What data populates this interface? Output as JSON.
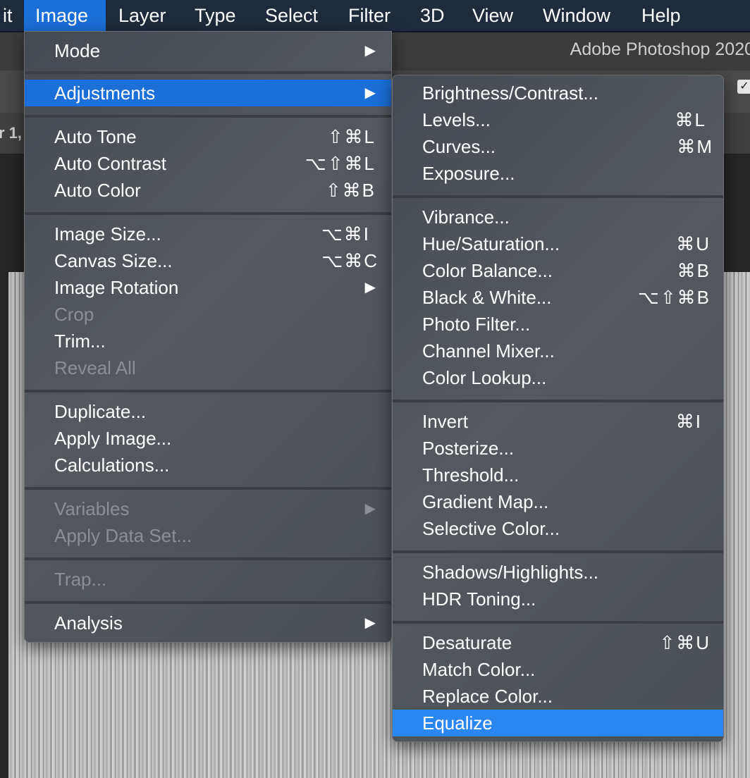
{
  "menubar": {
    "items": [
      "it",
      "Image",
      "Layer",
      "Type",
      "Select",
      "Filter",
      "3D",
      "View",
      "Window",
      "Help"
    ],
    "active": "Image"
  },
  "app": {
    "title": "Adobe Photoshop 2020",
    "tab_partial": "r 1,"
  },
  "image_menu": {
    "items": [
      {
        "label": "Mode",
        "submenu": true
      },
      {
        "label": "Adjustments",
        "submenu": true,
        "highlighted": true
      },
      {
        "label": "Auto Tone",
        "shortcut": "⇧⌘L"
      },
      {
        "label": "Auto Contrast",
        "shortcut": "⌥⇧⌘L"
      },
      {
        "label": "Auto Color",
        "shortcut": "⇧⌘B"
      },
      {
        "label": "Image Size...",
        "shortcut": "⌥⌘I"
      },
      {
        "label": "Canvas Size...",
        "shortcut": "⌥⌘C"
      },
      {
        "label": "Image Rotation",
        "submenu": true
      },
      {
        "label": "Crop",
        "disabled": true
      },
      {
        "label": "Trim..."
      },
      {
        "label": "Reveal All",
        "disabled": true
      },
      {
        "label": "Duplicate..."
      },
      {
        "label": "Apply Image..."
      },
      {
        "label": "Calculations..."
      },
      {
        "label": "Variables",
        "submenu": true,
        "disabled": true
      },
      {
        "label": "Apply Data Set...",
        "disabled": true
      },
      {
        "label": "Trap...",
        "disabled": true
      },
      {
        "label": "Analysis",
        "submenu": true
      }
    ]
  },
  "adjustments_menu": {
    "items": [
      {
        "label": "Brightness/Contrast..."
      },
      {
        "label": "Levels...",
        "shortcut": "⌘L"
      },
      {
        "label": "Curves...",
        "shortcut": "⌘M"
      },
      {
        "label": "Exposure..."
      },
      {
        "label": "Vibrance..."
      },
      {
        "label": "Hue/Saturation...",
        "shortcut": "⌘U"
      },
      {
        "label": "Color Balance...",
        "shortcut": "⌘B"
      },
      {
        "label": "Black & White...",
        "shortcut": "⌥⇧⌘B"
      },
      {
        "label": "Photo Filter..."
      },
      {
        "label": "Channel Mixer..."
      },
      {
        "label": "Color Lookup..."
      },
      {
        "label": "Invert",
        "shortcut": "⌘I"
      },
      {
        "label": "Posterize..."
      },
      {
        "label": "Threshold..."
      },
      {
        "label": "Gradient Map..."
      },
      {
        "label": "Selective Color..."
      },
      {
        "label": "Shadows/Highlights..."
      },
      {
        "label": "HDR Toning..."
      },
      {
        "label": "Desaturate",
        "shortcut": "⇧⌘U"
      },
      {
        "label": "Match Color..."
      },
      {
        "label": "Replace Color..."
      },
      {
        "label": "Equalize",
        "highlighted": true
      }
    ]
  },
  "icons": {
    "submenu_arrow": "triangle-right-icon",
    "checkbox": "checkbox-checked-icon"
  },
  "colors": {
    "highlight": "#1a6fd8",
    "highlight_sub": "#2a86f0",
    "menubar_bg": "#1f2a3d",
    "disabled_text": "#8b8e93"
  }
}
